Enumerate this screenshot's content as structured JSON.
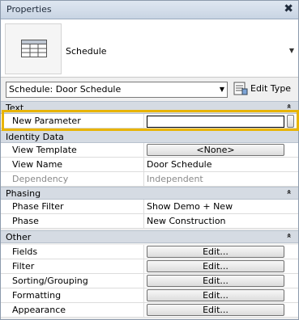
{
  "window": {
    "title": "Properties",
    "close_glyph": "✖"
  },
  "type_selector": {
    "type_name": "Schedule",
    "icon": "schedule-table-icon"
  },
  "instance_selector": {
    "value": "Schedule: Door Schedule",
    "edit_type_label": "Edit Type"
  },
  "sections": {
    "text": {
      "title": "Text",
      "chevron": "»"
    },
    "identity": {
      "title": "Identity Data",
      "chevron": "»"
    },
    "phasing": {
      "title": "Phasing",
      "chevron": "»"
    },
    "other": {
      "title": "Other",
      "chevron": "»"
    }
  },
  "rows": {
    "new_parameter": {
      "name": "New Parameter",
      "value": ""
    },
    "view_template": {
      "name": "View Template",
      "button": "<None>"
    },
    "view_name": {
      "name": "View Name",
      "value": "Door Schedule"
    },
    "dependency": {
      "name": "Dependency",
      "value": "Independent"
    },
    "phase_filter": {
      "name": "Phase Filter",
      "value": "Show Demo + New"
    },
    "phase": {
      "name": "Phase",
      "value": "New Construction"
    },
    "fields": {
      "name": "Fields",
      "button": "Edit..."
    },
    "filter": {
      "name": "Filter",
      "button": "Edit..."
    },
    "sorting": {
      "name": "Sorting/Grouping",
      "button": "Edit..."
    },
    "formatting": {
      "name": "Formatting",
      "button": "Edit..."
    },
    "appearance": {
      "name": "Appearance",
      "button": "Edit..."
    }
  },
  "colors": {
    "highlight": "#e8b400",
    "section_bg": "#d5dbe3"
  }
}
